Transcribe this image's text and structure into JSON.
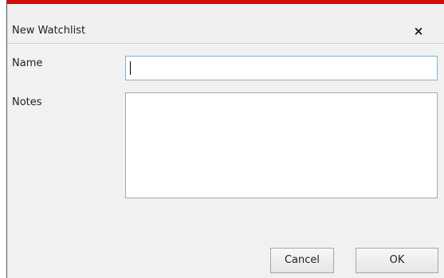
{
  "dialog": {
    "title": "New Watchlist",
    "close_label": "×",
    "accent_color": "#d20a0a"
  },
  "form": {
    "name_label": "Name",
    "name_value": "",
    "notes_label": "Notes",
    "notes_value": ""
  },
  "buttons": {
    "cancel_label": "Cancel",
    "ok_label": "OK"
  }
}
